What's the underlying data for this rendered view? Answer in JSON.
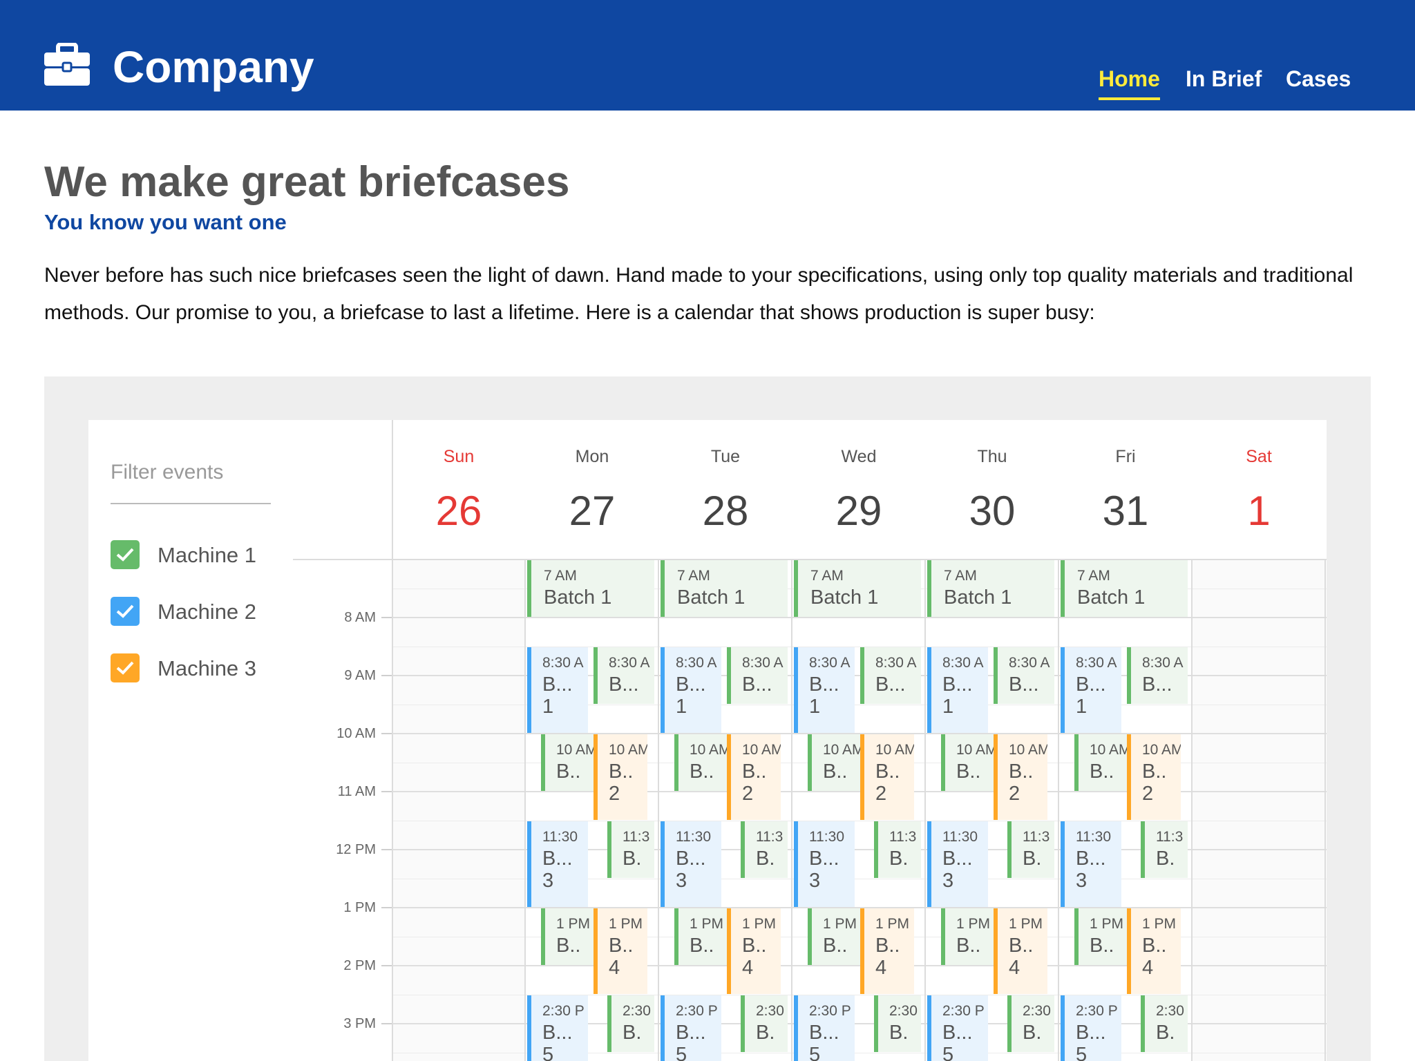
{
  "header": {
    "brand": "Company",
    "logo_icon": "briefcase-icon",
    "nav": [
      {
        "label": "Home",
        "active": true
      },
      {
        "label": "In Brief",
        "active": false
      },
      {
        "label": "Cases",
        "active": false
      }
    ],
    "colors": {
      "background": "#0f47a1",
      "active_nav": "#ffeb3b"
    }
  },
  "intro": {
    "title": "We make great briefcases",
    "subtitle": "You know you want one",
    "paragraph": "Never before has such nice briefcases seen the light of dawn. Hand made to your specifications, using only top quality materials and traditional methods. Our promise to you, a briefcase to last a lifetime. Here is a calendar that shows production is super busy:"
  },
  "filter": {
    "placeholder": "Filter events",
    "machines": [
      {
        "label": "Machine 1",
        "checked": true,
        "color": "#66bb6a"
      },
      {
        "label": "Machine 2",
        "checked": true,
        "color": "#42a5f5"
      },
      {
        "label": "Machine 3",
        "checked": true,
        "color": "#ffa726"
      }
    ]
  },
  "calendar": {
    "days": [
      {
        "name": "Sun",
        "date": "26",
        "weekend": true
      },
      {
        "name": "Mon",
        "date": "27",
        "weekend": false
      },
      {
        "name": "Tue",
        "date": "28",
        "weekend": false
      },
      {
        "name": "Wed",
        "date": "29",
        "weekend": false
      },
      {
        "name": "Thu",
        "date": "30",
        "weekend": false
      },
      {
        "name": "Fri",
        "date": "31",
        "weekend": false
      },
      {
        "name": "Sat",
        "date": "1",
        "weekend": true
      }
    ],
    "hours": [
      "8 AM",
      "9 AM",
      "10 AM",
      "11 AM",
      "12 PM",
      "1 PM",
      "2 PM",
      "3 PM"
    ],
    "event_template": [
      {
        "time": "7 AM",
        "name": "Batch 1",
        "machine": "Machine 1"
      },
      {
        "time": "8:30 A",
        "name": "B... 1",
        "machine": "Machine 2"
      },
      {
        "time": "8:30 A",
        "name": "B...",
        "machine": "Machine 1"
      },
      {
        "time": "10 AM",
        "name": "B..",
        "machine": "Machine 1"
      },
      {
        "time": "10 AM",
        "name": "B.. 2",
        "machine": "Machine 3"
      },
      {
        "time": "11:30",
        "name": "B... 3",
        "machine": "Machine 2"
      },
      {
        "time": "11:3",
        "name": "B.",
        "machine": "Machine 1"
      },
      {
        "time": "1 PM",
        "name": "B..",
        "machine": "Machine 1"
      },
      {
        "time": "1 PM",
        "name": "B.. 4",
        "machine": "Machine 3"
      },
      {
        "time": "2:30 P",
        "name": "B... 5",
        "machine": "Machine 2"
      },
      {
        "time": "2:30",
        "name": "B.",
        "machine": "Machine 1"
      }
    ],
    "event_days": [
      "Mon",
      "Tue",
      "Wed",
      "Thu",
      "Fri"
    ]
  }
}
